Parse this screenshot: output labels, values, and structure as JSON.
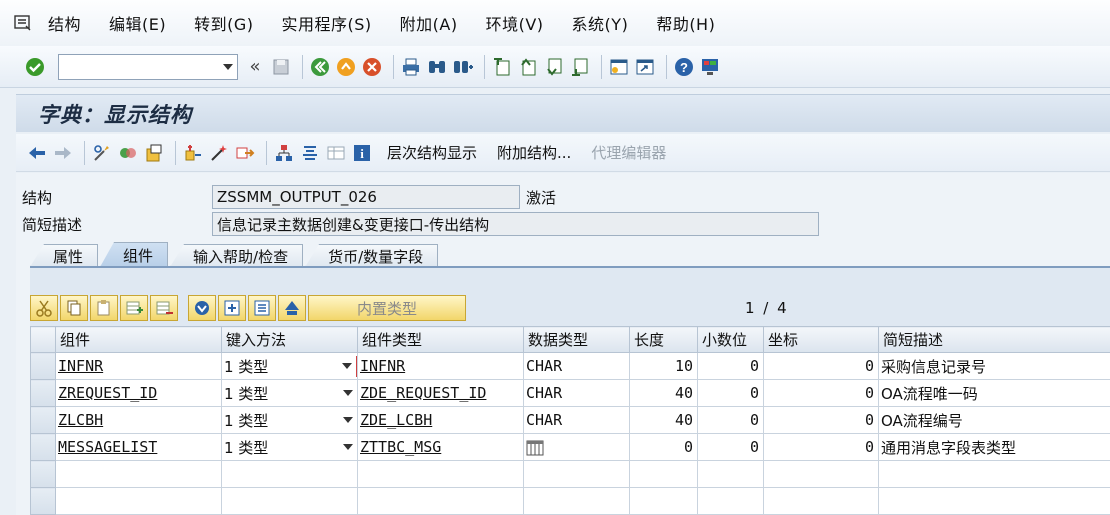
{
  "menu": {
    "items": [
      "结构",
      "编辑(E)",
      "转到(G)",
      "实用程序(S)",
      "附加(A)",
      "环境(V)",
      "系统(Y)",
      "帮助(H)"
    ]
  },
  "toolbar": {
    "command_value": "",
    "back_label": "«"
  },
  "title": "字典：显示结构",
  "app_toolbar": {
    "hierarchy_label": "层次结构显示",
    "append_label": "附加结构...",
    "proxy_label": "代理编辑器"
  },
  "fields": {
    "structure_label": "结构",
    "structure_value": "ZSSMM_OUTPUT_026",
    "status": "激活",
    "desc_label": "简短描述",
    "desc_value": "信息记录主数据创建&变更接口-传出结构"
  },
  "tabs": [
    "属性",
    "组件",
    "输入帮助/检查",
    "货币/数量字段"
  ],
  "active_tab": 1,
  "grid_toolbar": {
    "builtin_type_label": "内置类型",
    "page_indicator": "1 / 4"
  },
  "table": {
    "headers": [
      "组件",
      "键入方法",
      "组件类型",
      "数据类型",
      "长度",
      "小数位",
      "坐标",
      "简短描述"
    ],
    "rows": [
      {
        "component": "INFNR",
        "method": "1 类型",
        "type": "INFNR",
        "datatype": "CHAR",
        "length": "10",
        "decimals": "0",
        "coord": "0",
        "desc": "采购信息记录号"
      },
      {
        "component": "ZREQUEST_ID",
        "method": "1 类型",
        "type": "ZDE_REQUEST_ID",
        "datatype": "CHAR",
        "length": "40",
        "decimals": "0",
        "coord": "0",
        "desc": "OA流程唯一码"
      },
      {
        "component": "ZLCBH",
        "method": "1 类型",
        "type": "ZDE_LCBH",
        "datatype": "CHAR",
        "length": "40",
        "decimals": "0",
        "coord": "0",
        "desc": "OA流程编号"
      },
      {
        "component": "MESSAGELIST",
        "method": "1 类型",
        "type": "ZTTBC_MSG",
        "datatype": "",
        "length": "0",
        "decimals": "0",
        "coord": "0",
        "desc": "通用消息字段表类型"
      }
    ]
  },
  "colors": {
    "title_text": "#1d2d44",
    "ok_green": "#3a9a2a",
    "grid_button_yellow": "#f2d66a"
  }
}
